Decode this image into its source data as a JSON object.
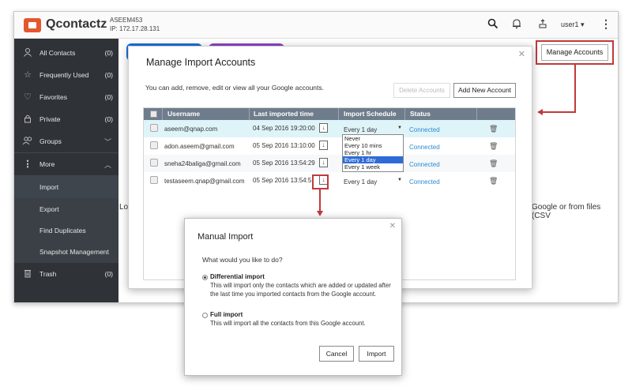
{
  "app": {
    "title": "Qcontactz",
    "nas_name": "ASEEM453",
    "nas_ip": "IP: 172.17.28.131",
    "user": "user1",
    "brand_color": "#e4572e"
  },
  "sidebar": {
    "items": [
      {
        "label": "All Contacts",
        "count": "(0)",
        "icon": "person-icon"
      },
      {
        "label": "Frequently Used",
        "count": "(0)",
        "icon": "star-icon"
      },
      {
        "label": "Favorites",
        "count": "(0)",
        "icon": "heart-icon"
      },
      {
        "label": "Private",
        "count": "(0)",
        "icon": "lock-icon"
      },
      {
        "label": "Groups",
        "icon": "group-icon"
      },
      {
        "label": "More",
        "icon": "kebab-icon"
      },
      {
        "label": "Import"
      },
      {
        "label": "Export"
      },
      {
        "label": "Find Duplicates"
      },
      {
        "label": "Snapshot Management"
      },
      {
        "label": "Trash",
        "count": "(0)",
        "icon": "trash-icon"
      }
    ]
  },
  "background": {
    "text_left": "Lo",
    "text_right": "Google or from files (CSV"
  },
  "manage_accounts_button": "Manage Accounts",
  "manage_dialog": {
    "title": "Manage Import Accounts",
    "description": "You can add, remove, edit or view all your Google accounts.",
    "delete_button": "Delete Accounts",
    "add_button": "Add New Account",
    "columns": [
      "Username",
      "Last imported time",
      "Import Schedule",
      "Status"
    ],
    "rows": [
      {
        "username": "aseem@qnap.com",
        "time": "04 Sep 2016 19:20:00",
        "schedule": "Every 1 day",
        "status": "Connected"
      },
      {
        "username": "adon.aseem@gmail.com",
        "time": "05 Sep 2016 13:10:00",
        "schedule": "",
        "status": "Connected"
      },
      {
        "username": "sneha24baliga@gmail.com",
        "time": "05 Sep 2016 13:54:29",
        "schedule": "",
        "status": "Connected"
      },
      {
        "username": "testaseem.qnap@gmail.com",
        "time": "05 Sep 2016 13:54:5",
        "schedule": "Every 1 day",
        "status": "Connected"
      }
    ],
    "schedule_options": [
      "Never",
      "Every 10 mins",
      "Every 1 hr",
      "Every 1 day",
      "Every 1 week"
    ],
    "selected_schedule": "Every 1 day",
    "accent_color": "#2a8bd0"
  },
  "manual_dialog": {
    "title": "Manual Import",
    "question": "What would you like to do?",
    "option1_title": "Differential import",
    "option1_desc": "This will import only the contacts which are added or updated after the last time you imported contacts from the Google account.",
    "option2_title": "Full import",
    "option2_desc": "This will import all the contacts from this Google account.",
    "cancel_button": "Cancel",
    "import_button": "Import"
  },
  "highlight_color": "#c03a3a"
}
